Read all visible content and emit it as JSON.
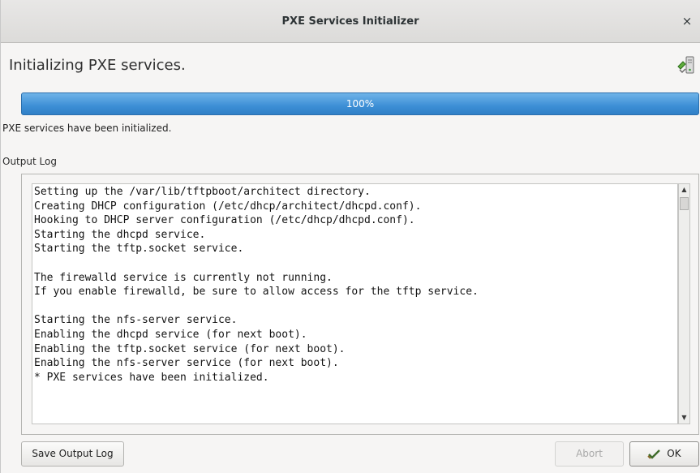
{
  "window": {
    "title": "PXE Services Initializer",
    "close_glyph": "×"
  },
  "heading": "Initializing PXE services.",
  "status_icon": "server-config-icon",
  "progress": {
    "value_percent": 100,
    "label": "100%",
    "color": "#3d8fd6"
  },
  "status_text": "PXE services have been initialized.",
  "output_log": {
    "label": "Output Log",
    "lines": [
      "Setting up the /var/lib/tftpboot/architect directory.",
      "Creating DHCP configuration (/etc/dhcp/architect/dhcpd.conf).",
      "Hooking to DHCP server configuration (/etc/dhcp/dhcpd.conf).",
      "Starting the dhcpd service.",
      "Starting the tftp.socket service.",
      "",
      "The firewalld service is currently not running.",
      "If you enable firewalld, be sure to allow access for the tftp service.",
      "",
      "Starting the nfs-server service.",
      "Enabling the dhcpd service (for next boot).",
      "Enabling the tftp.socket service (for next boot).",
      "Enabling the nfs-server service (for next boot).",
      "* PXE services have been initialized."
    ]
  },
  "buttons": {
    "save_label": "Save Output Log",
    "abort_label": "Abort",
    "ok_label": "OK",
    "ok_icon": "checkmark-icon"
  }
}
